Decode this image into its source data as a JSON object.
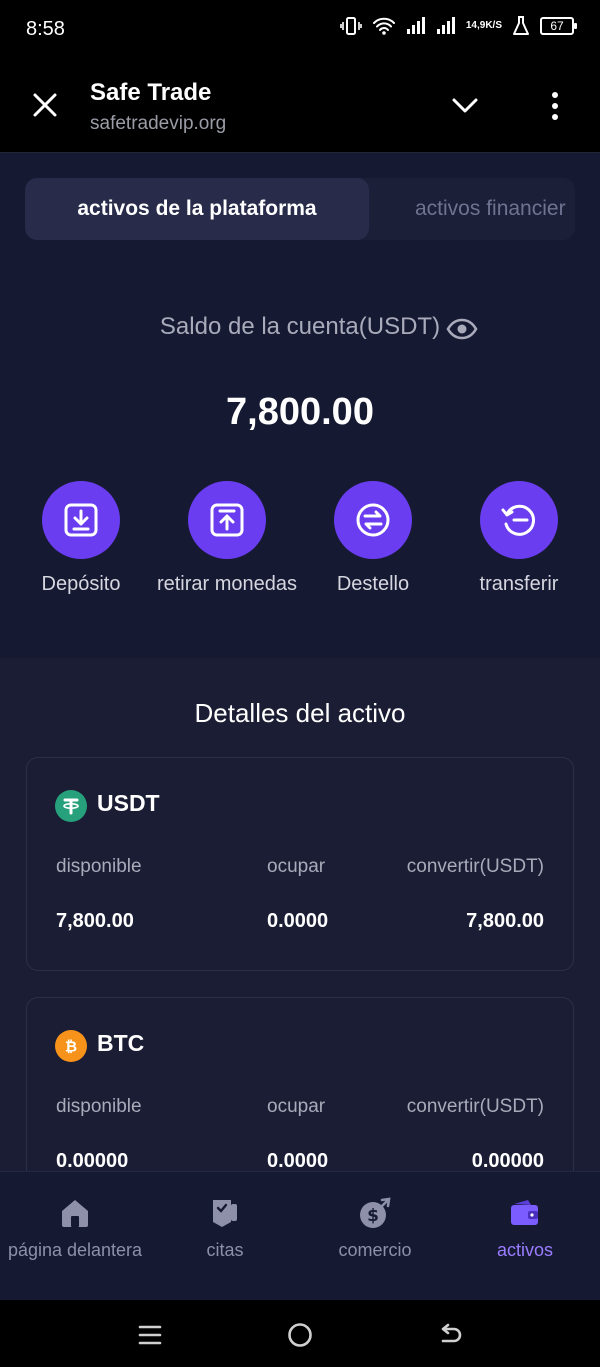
{
  "status_bar": {
    "time": "8:58",
    "net_speed_value": "14,9",
    "net_speed_unit": "K/S",
    "battery": "67"
  },
  "browser": {
    "title": "Safe Trade",
    "url": "safetradevip.org"
  },
  "tabs": {
    "active": "activos de la plataforma",
    "inactive": "activos financier"
  },
  "balance": {
    "label": "Saldo de la cuenta(USDT)",
    "value": "7,800.00"
  },
  "actions": [
    {
      "label": "Depósito",
      "icon": "deposit-icon"
    },
    {
      "label": "retirar monedas",
      "icon": "withdraw-icon"
    },
    {
      "label": "Destello",
      "icon": "swap-icon"
    },
    {
      "label": "transferir",
      "icon": "transfer-icon"
    }
  ],
  "details": {
    "title": "Detalles del activo",
    "assets": [
      {
        "name": "USDT",
        "icon": "tether-icon",
        "icon_color": "#26a17b",
        "headers": [
          "disponible",
          "ocupar",
          "convertir(USDT)"
        ],
        "values": [
          "7,800.00",
          "0.0000",
          "7,800.00"
        ]
      },
      {
        "name": "BTC",
        "icon": "bitcoin-icon",
        "icon_color": "#f7931a",
        "headers": [
          "disponible",
          "ocupar",
          "convertir(USDT)"
        ],
        "values": [
          "0.00000",
          "0.0000",
          "0.00000"
        ]
      }
    ]
  },
  "bottom_nav": [
    {
      "label": "página delantera",
      "icon": "home-icon"
    },
    {
      "label": "citas",
      "icon": "quotes-icon"
    },
    {
      "label": "comercio",
      "icon": "trade-icon"
    },
    {
      "label": "activos",
      "icon": "wallet-icon",
      "active": true
    }
  ],
  "colors": {
    "accent": "#6a3df0",
    "background": "#1a1d33",
    "active_nav": "#9a7dff"
  }
}
